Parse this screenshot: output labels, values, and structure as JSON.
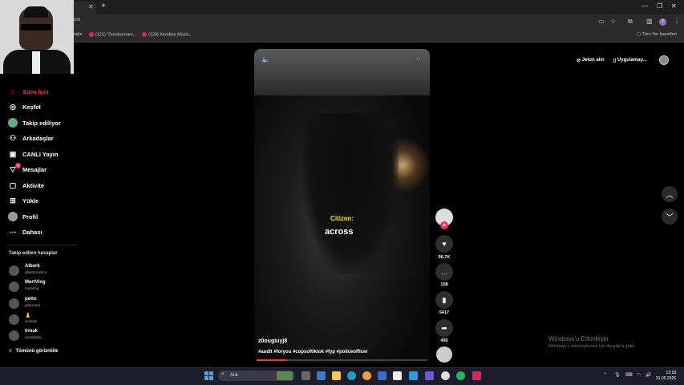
{
  "browser": {
    "tab_title": "y",
    "url": "om",
    "bookmarks": [
      "ogle",
      "(121) \"Dondurmam...",
      "(128) Kendine Müzis..."
    ],
    "all_bookmarks": "Tüm Yer İşaretleri",
    "profile_initial": "Y"
  },
  "sidebar": {
    "items": [
      {
        "label": "Sizin İçin",
        "icon": "home-icon",
        "active": true
      },
      {
        "label": "Keşfet",
        "icon": "compass-icon"
      },
      {
        "label": "Takip ediliyor",
        "icon": "following-avatar-icon"
      },
      {
        "label": "Arkadaşlar",
        "icon": "friends-icon"
      },
      {
        "label": "CANLI Yayın",
        "icon": "live-icon"
      },
      {
        "label": "Mesajlar",
        "icon": "messages-icon",
        "badge": "9"
      },
      {
        "label": "Aktivite",
        "icon": "activity-icon"
      },
      {
        "label": "Yükle",
        "icon": "upload-icon"
      },
      {
        "label": "Profil",
        "icon": "profile-icon"
      },
      {
        "label": "Dahası",
        "icon": "more-dots-icon"
      }
    ],
    "following_title": "Takip edilen hesaplar",
    "accounts": [
      {
        "name": "Alberk",
        "handle": "alberkozdemi"
      },
      {
        "name": "MertVlog",
        "handle": "mertvlog"
      },
      {
        "name": "petto",
        "handle": "pettoosss"
      },
      {
        "name": "👃",
        "handle": "slmkrpli"
      },
      {
        "name": "Irmak",
        "handle": "naraistitka"
      }
    ],
    "see_all": "Tümünü görüntüle"
  },
  "topbar": {
    "coins": "Jeton alın",
    "app": "Uygulamay..."
  },
  "video": {
    "caption_speaker": "Citizen:",
    "caption_word": "across",
    "username": "z0ougiuyj8",
    "description": "#audit #foryou #copsoftiktok #fyp #policeofficer",
    "progress": 0.18
  },
  "actions": {
    "likes": "96.7K",
    "comments": "158",
    "saves": "5417",
    "shares": "495"
  },
  "watermark": {
    "title": "Windows'u Etkinleştir",
    "subtitle": "Windows'u etkinleştirmek için Ayarlar'a gidin."
  },
  "taskbar": {
    "search_label": "Ara",
    "time": "13:18",
    "date": "31.05.2026"
  },
  "colors": {
    "accent": "#fe2c55",
    "caption_yellow": "#ffe600"
  }
}
